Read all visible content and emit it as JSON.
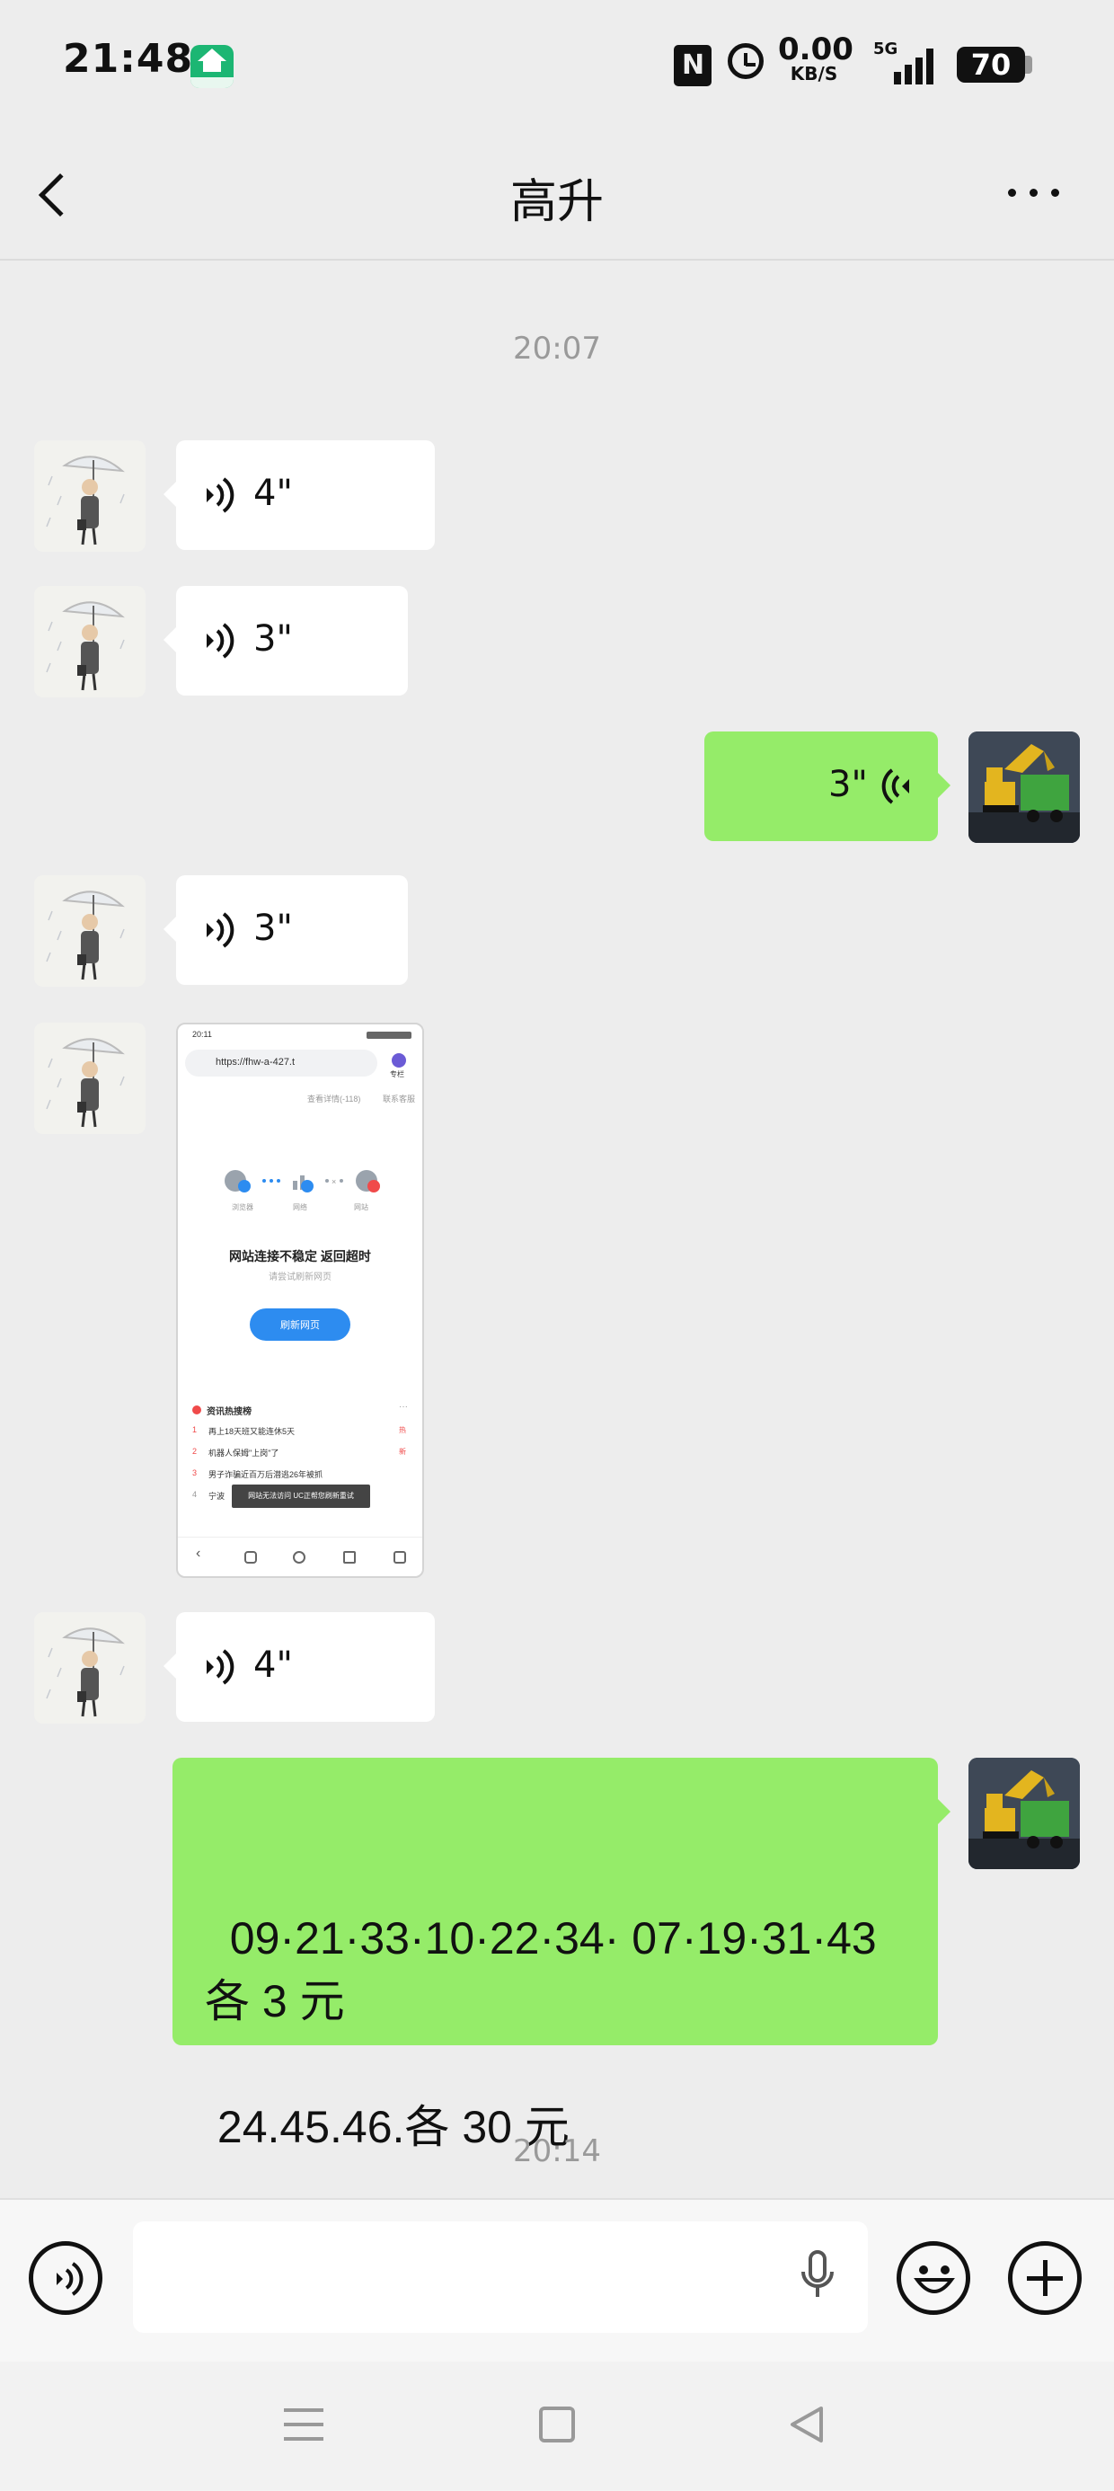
{
  "status_bar": {
    "time": "21:48",
    "net_speed": "0.00",
    "net_speed_unit": "KB/S",
    "network_type": "5G",
    "battery": "70",
    "icons": [
      "app-badge-icon",
      "nfc-icon",
      "alarm-icon",
      "signal-icon",
      "battery-icon"
    ]
  },
  "header": {
    "title": "高升",
    "back_icon": "chevron-left-icon",
    "more_icon": "more-dots-icon"
  },
  "chat": {
    "time_separators": [
      "20:07",
      "20:14"
    ],
    "messages": [
      {
        "type": "voice",
        "direction": "in",
        "duration": "4\""
      },
      {
        "type": "voice",
        "direction": "in",
        "duration": "3\""
      },
      {
        "type": "voice",
        "direction": "out",
        "duration": "3\""
      },
      {
        "type": "voice",
        "direction": "in",
        "duration": "3\""
      },
      {
        "type": "image",
        "direction": "in"
      },
      {
        "type": "voice",
        "direction": "in",
        "duration": "4\""
      },
      {
        "type": "text",
        "direction": "out",
        "text": "09·21·33·10·22·34· 07·19·31·43 各 3 元\n\n 24.45.46.各 30 元"
      }
    ]
  },
  "screenshot_preview": {
    "time": "20:11",
    "url": "https://fhw-a-427.t",
    "corner_label": "专栏",
    "links": [
      "查看详情(-118)",
      "联系客服"
    ],
    "diagram_labels": [
      "浏览器",
      "网络",
      "网站"
    ],
    "error_title": "网站连接不稳定 返回超时",
    "error_subtitle": "请尝试刷新网页",
    "refresh_button": "刷新网页",
    "news_header": "资讯热搜榜",
    "news": [
      {
        "rank": "1",
        "title": "再上18天班又能连休5天",
        "tag": "热"
      },
      {
        "rank": "2",
        "title": "机器人保姆\"上岗\"了",
        "tag": "新"
      },
      {
        "rank": "3",
        "title": "男子诈骗近百万后潜逃26年被抓",
        "tag": ""
      },
      {
        "rank": "4",
        "title": "宁波",
        "tag": ""
      }
    ],
    "toast": "网站无法访问 UC正帮您刷新重试"
  },
  "input_bar": {
    "voice_toggle_icon": "voice-toggle-icon",
    "mic_icon": "microphone-icon",
    "emoji_icon": "emoji-icon",
    "plus_icon": "plus-icon",
    "placeholder": ""
  },
  "nav_bar": {
    "icons": [
      "menu-icon",
      "home-square-icon",
      "back-triangle-icon"
    ]
  }
}
